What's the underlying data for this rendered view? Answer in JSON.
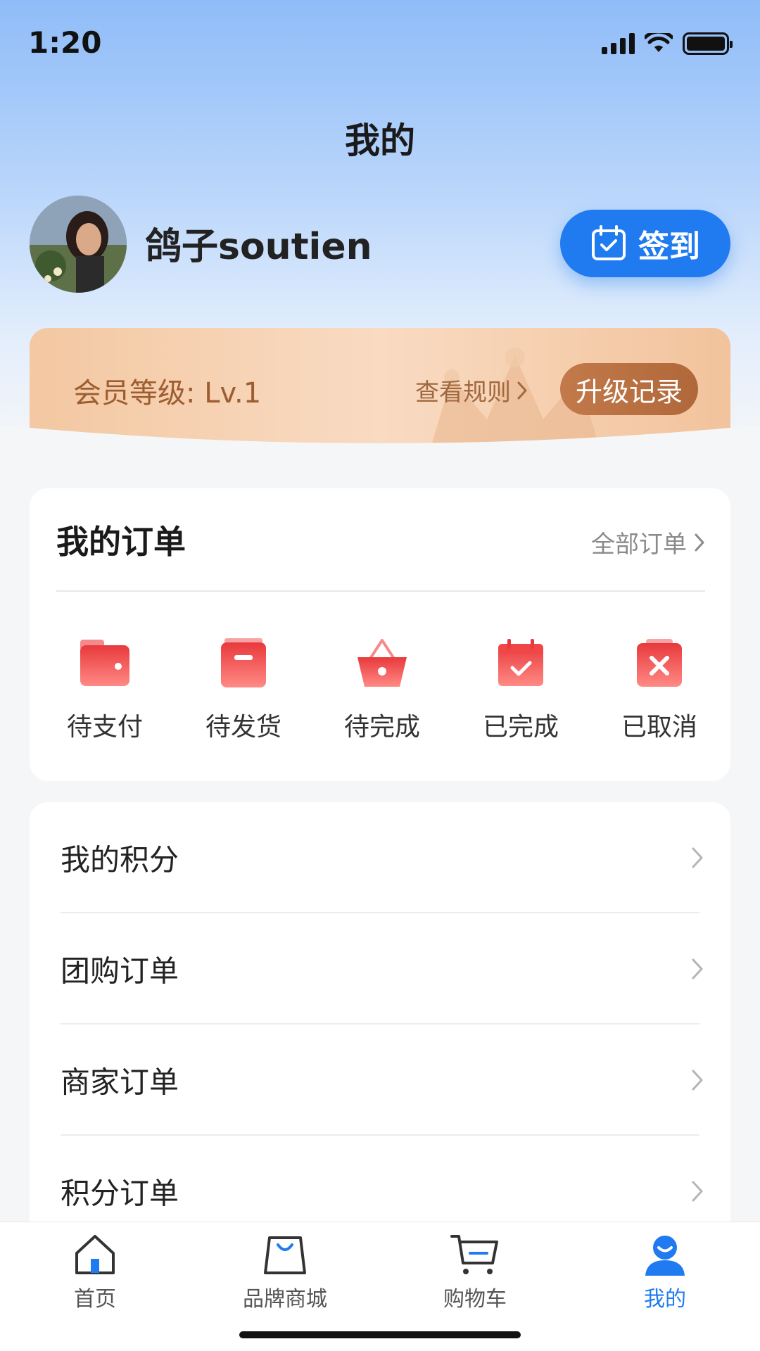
{
  "status_bar": {
    "time": "1:20"
  },
  "page": {
    "title": "我的"
  },
  "profile": {
    "username": "鸽子soutien",
    "checkin_label": "签到"
  },
  "member": {
    "level": "会员等级: Lv.1",
    "rules": "查看规则",
    "upgrade": "升级记录"
  },
  "orders": {
    "title": "我的订单",
    "all_label": "全部订单",
    "statuses": [
      {
        "label": "待支付",
        "icon": "wallet-icon"
      },
      {
        "label": "待发货",
        "icon": "package-icon"
      },
      {
        "label": "待完成",
        "icon": "basket-icon"
      },
      {
        "label": "已完成",
        "icon": "calendar-check-icon"
      },
      {
        "label": "已取消",
        "icon": "cancel-icon"
      }
    ]
  },
  "menu": {
    "items": [
      {
        "label": "我的积分"
      },
      {
        "label": "团购订单"
      },
      {
        "label": "商家订单"
      },
      {
        "label": "积分订单"
      }
    ]
  },
  "tabbar": {
    "tabs": [
      {
        "label": "首页",
        "icon": "home-icon"
      },
      {
        "label": "品牌商城",
        "icon": "shopping-bag-icon"
      },
      {
        "label": "购物车",
        "icon": "cart-icon"
      },
      {
        "label": "我的",
        "icon": "user-icon"
      }
    ],
    "active_index": 3
  },
  "colors": {
    "accent": "#1f7bef",
    "member_text": "#9d5d30",
    "status_red": "#ee4b4b"
  }
}
